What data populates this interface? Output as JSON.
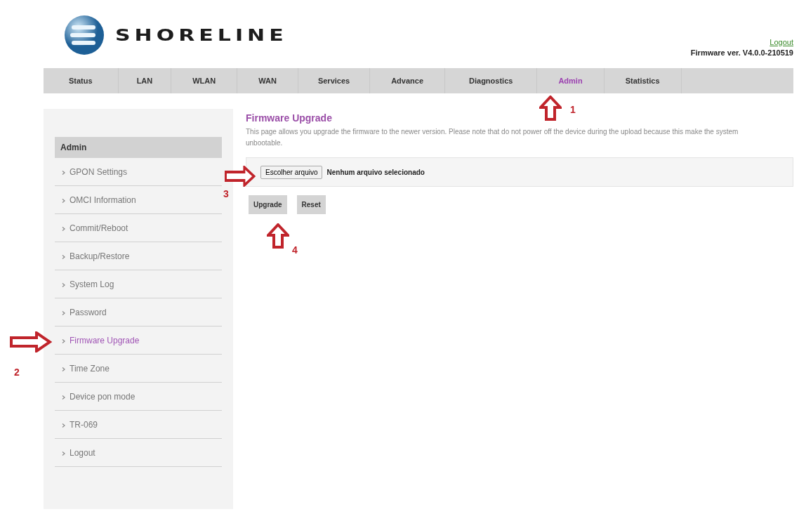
{
  "header": {
    "brand": "SHORELINE",
    "logout": "Logout",
    "firmware_version": "Firmware ver. V4.0.0-210519"
  },
  "nav": [
    {
      "label": "Status",
      "selected": false
    },
    {
      "label": "LAN",
      "selected": false
    },
    {
      "label": "WLAN",
      "selected": false
    },
    {
      "label": "WAN",
      "selected": false
    },
    {
      "label": "Services",
      "selected": false
    },
    {
      "label": "Advance",
      "selected": false
    },
    {
      "label": "Diagnostics",
      "selected": false
    },
    {
      "label": "Admin",
      "selected": true
    },
    {
      "label": "Statistics",
      "selected": false
    }
  ],
  "sidebar": {
    "title": "Admin",
    "items": [
      {
        "label": "GPON Settings",
        "selected": false
      },
      {
        "label": "OMCI Information",
        "selected": false
      },
      {
        "label": "Commit/Reboot",
        "selected": false
      },
      {
        "label": "Backup/Restore",
        "selected": false
      },
      {
        "label": "System Log",
        "selected": false
      },
      {
        "label": "Password",
        "selected": false
      },
      {
        "label": "Firmware Upgrade",
        "selected": true
      },
      {
        "label": "Time Zone",
        "selected": false
      },
      {
        "label": "Device pon mode",
        "selected": false
      },
      {
        "label": "TR-069",
        "selected": false
      },
      {
        "label": "Logout",
        "selected": false
      }
    ]
  },
  "content": {
    "title": "Firmware Upgrade",
    "description": "This page allows you upgrade the firmware to the newer version. Please note that do not power off the device during the upload because this make the system unbootable.",
    "file_button": "Escolher arquivo",
    "file_status": "Nenhum arquivo selecionado",
    "buttons": [
      "Upgrade",
      "Reset"
    ]
  },
  "annotations": [
    {
      "label": "1",
      "kind": "up"
    },
    {
      "label": "2",
      "kind": "right"
    },
    {
      "label": "3",
      "kind": "right"
    },
    {
      "label": "4",
      "kind": "up"
    }
  ]
}
